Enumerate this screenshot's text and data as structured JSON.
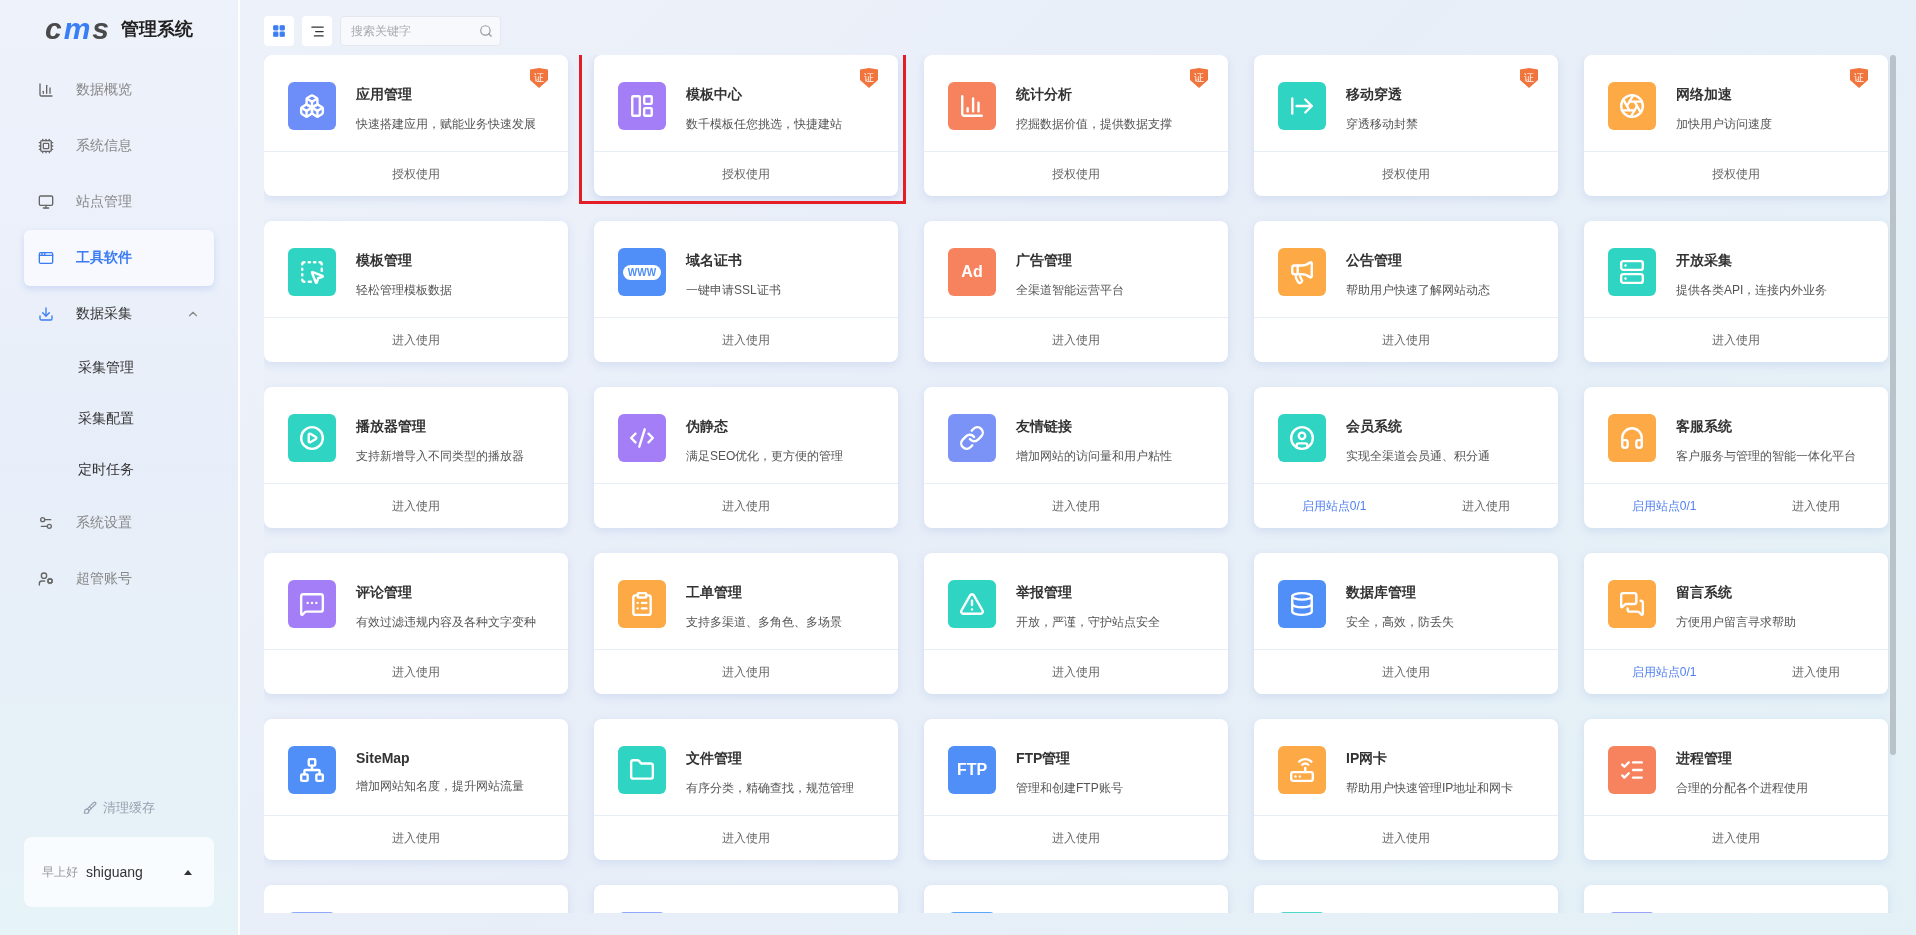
{
  "sidebar": {
    "logo": {
      "letters": [
        "c",
        "m",
        "s"
      ],
      "title": "管理系统"
    },
    "items": [
      {
        "label": "数据概览",
        "selected": false
      },
      {
        "label": "系统信息",
        "selected": false
      },
      {
        "label": "站点管理",
        "selected": false
      },
      {
        "label": "工具软件",
        "selected": true
      },
      {
        "label": "数据采集",
        "selected": false,
        "expanded": true,
        "children": [
          {
            "label": "采集管理",
            "selected": false
          },
          {
            "label": "采集配置",
            "selected": false
          },
          {
            "label": "定时任务",
            "selected": false
          }
        ]
      },
      {
        "label": "系统设置",
        "selected": false
      },
      {
        "label": "超管账号",
        "selected": false
      }
    ],
    "clear_cache": "清理缓存",
    "user": {
      "greeting": "早上好",
      "name": "shiguang"
    }
  },
  "toolbar": {
    "view_buttons": [
      {
        "selected": true
      },
      {
        "selected": false
      }
    ],
    "search": {
      "placeholder": "搜索关键字"
    }
  },
  "cards": [
    {
      "title": "应用管理",
      "description": "快速搭建应用，赋能业务快速发展",
      "badge": "证",
      "color": "#6d8ef8",
      "highlighted": false,
      "actions": [
        {
          "label": "授权使用",
          "kind": "plain"
        }
      ]
    },
    {
      "title": "模板中心",
      "description": "数千模板任您挑选，快捷建站",
      "badge": "证",
      "color": "#a47ef6",
      "highlighted": true,
      "actions": [
        {
          "label": "授权使用",
          "kind": "plain"
        }
      ]
    },
    {
      "title": "统计分析",
      "description": "挖掘数据价值，提供数据支撑",
      "badge": "证",
      "color": "#f7825e",
      "highlighted": false,
      "actions": [
        {
          "label": "授权使用",
          "kind": "plain"
        }
      ]
    },
    {
      "title": "移动穿透",
      "description": "穿透移动封禁",
      "badge": "证",
      "color": "#2fd4c3",
      "highlighted": false,
      "actions": [
        {
          "label": "授权使用",
          "kind": "plain"
        }
      ]
    },
    {
      "title": "网络加速",
      "description": "加快用户访问速度",
      "badge": "证",
      "color": "#fca946",
      "highlighted": false,
      "actions": [
        {
          "label": "授权使用",
          "kind": "plain"
        }
      ]
    },
    {
      "title": "模板管理",
      "description": "轻松管理模板数据",
      "color": "#2fd4c3",
      "highlighted": false,
      "actions": [
        {
          "label": "进入使用",
          "kind": "plain"
        }
      ]
    },
    {
      "title": "域名证书",
      "description": "一键申请SSL证书",
      "color": "#4f8ff7",
      "icon_text": "WWW",
      "highlighted": false,
      "actions": [
        {
          "label": "进入使用",
          "kind": "plain"
        }
      ]
    },
    {
      "title": "广告管理",
      "description": "全渠道智能运营平台",
      "color": "#f7825e",
      "icon_text": "Ad",
      "highlighted": false,
      "actions": [
        {
          "label": "进入使用",
          "kind": "plain"
        }
      ]
    },
    {
      "title": "公告管理",
      "description": "帮助用户快速了解网站动态",
      "color": "#fca946",
      "highlighted": false,
      "actions": [
        {
          "label": "进入使用",
          "kind": "plain"
        }
      ]
    },
    {
      "title": "开放采集",
      "description": "提供各类API，连接内外业务",
      "color": "#2fd4c3",
      "highlighted": false,
      "actions": [
        {
          "label": "进入使用",
          "kind": "plain"
        }
      ]
    },
    {
      "title": "播放器管理",
      "description": "支持新增导入不同类型的播放器",
      "color": "#2fd4c3",
      "highlighted": false,
      "actions": [
        {
          "label": "进入使用",
          "kind": "plain"
        }
      ]
    },
    {
      "title": "伪静态",
      "description": "满足SEO优化，更方便的管理",
      "color": "#a47ef6",
      "highlighted": false,
      "actions": [
        {
          "label": "进入使用",
          "kind": "plain"
        }
      ]
    },
    {
      "title": "友情链接",
      "description": "增加网站的访问量和用户粘性",
      "color": "#7b93f6",
      "highlighted": false,
      "actions": [
        {
          "label": "进入使用",
          "kind": "plain"
        }
      ]
    },
    {
      "title": "会员系统",
      "description": "实现全渠道会员通、积分通",
      "color": "#2fd4c3",
      "highlighted": false,
      "actions": [
        {
          "label": "启用站点0/1",
          "kind": "link"
        },
        {
          "label": "进入使用",
          "kind": "plain"
        }
      ]
    },
    {
      "title": "客服系统",
      "description": "客户服务与管理的智能一体化平台",
      "color": "#fca946",
      "highlighted": false,
      "actions": [
        {
          "label": "启用站点0/1",
          "kind": "link"
        },
        {
          "label": "进入使用",
          "kind": "plain"
        }
      ]
    },
    {
      "title": "评论管理",
      "description": "有效过滤违规内容及各种文字变种",
      "color": "#a47ef6",
      "highlighted": false,
      "actions": [
        {
          "label": "进入使用",
          "kind": "plain"
        }
      ]
    },
    {
      "title": "工单管理",
      "description": "支持多渠道、多角色、多场景",
      "color": "#fca946",
      "highlighted": false,
      "actions": [
        {
          "label": "进入使用",
          "kind": "plain"
        }
      ]
    },
    {
      "title": "举报管理",
      "description": "开放，严谨，守护站点安全",
      "color": "#2fd4c3",
      "highlighted": false,
      "actions": [
        {
          "label": "进入使用",
          "kind": "plain"
        }
      ]
    },
    {
      "title": "数据库管理",
      "description": "安全，高效，防丢失",
      "color": "#4f8ff7",
      "highlighted": false,
      "actions": [
        {
          "label": "进入使用",
          "kind": "plain"
        }
      ]
    },
    {
      "title": "留言系统",
      "description": "方便用户留言寻求帮助",
      "color": "#fca946",
      "highlighted": false,
      "actions": [
        {
          "label": "启用站点0/1",
          "kind": "link"
        },
        {
          "label": "进入使用",
          "kind": "plain"
        }
      ]
    },
    {
      "title": "SiteMap",
      "description": "增加网站知名度，提升网站流量",
      "color": "#4f8ff7",
      "highlighted": false,
      "actions": [
        {
          "label": "进入使用",
          "kind": "plain"
        }
      ]
    },
    {
      "title": "文件管理",
      "description": "有序分类，精确查找，规范管理",
      "color": "#2fd4c3",
      "highlighted": false,
      "actions": [
        {
          "label": "进入使用",
          "kind": "plain"
        }
      ]
    },
    {
      "title": "FTP管理",
      "description": "管理和创建FTP账号",
      "color": "#4f8ff7",
      "icon_text": "FTP",
      "highlighted": false,
      "actions": [
        {
          "label": "进入使用",
          "kind": "plain"
        }
      ]
    },
    {
      "title": "IP网卡",
      "description": "帮助用户快速管理IP地址和网卡",
      "color": "#fca946",
      "highlighted": false,
      "actions": [
        {
          "label": "进入使用",
          "kind": "plain"
        }
      ]
    },
    {
      "title": "进程管理",
      "description": "合理的分配各个进程使用",
      "color": "#f7825e",
      "highlighted": false,
      "actions": [
        {
          "label": "进入使用",
          "kind": "plain"
        }
      ]
    }
  ],
  "partial_cards": [
    {
      "color": "#8fa8f8"
    },
    {
      "color": "#8fa8f8"
    },
    {
      "color": "#5aa8f7"
    },
    {
      "color": "#4fd8c8"
    },
    {
      "color": "#9aa2f8"
    }
  ]
}
